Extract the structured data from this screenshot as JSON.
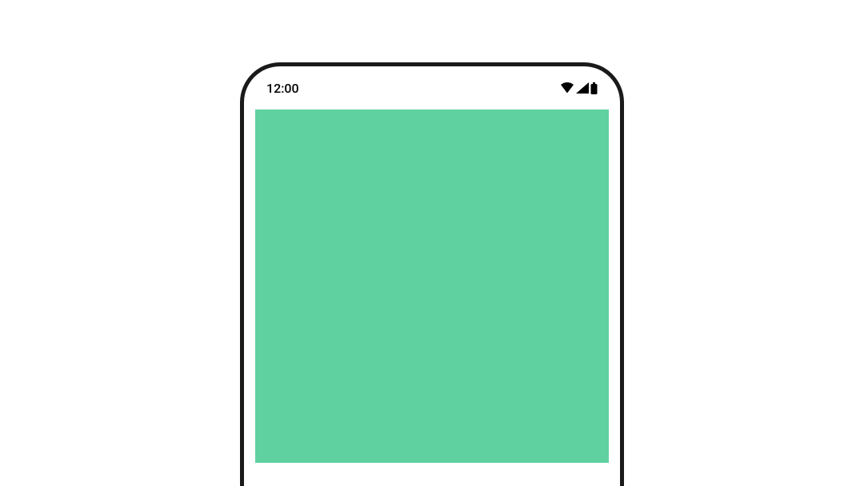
{
  "status_bar": {
    "time": "12:00"
  },
  "theme": {
    "box_color": "#5fd0a0",
    "frame_color": "#1a1a1a",
    "background": "#ffffff"
  }
}
